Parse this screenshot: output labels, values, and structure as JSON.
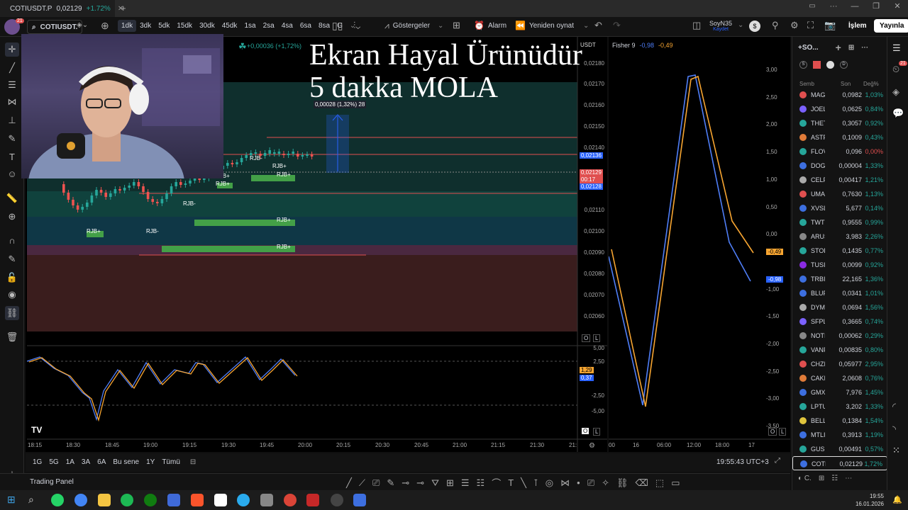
{
  "window": {
    "tab_title": "COTIUSDT.P",
    "tab_price": "0,02129",
    "tab_change": "+1.72%",
    "controls": [
      "—",
      "❐",
      "✕"
    ]
  },
  "toolbar": {
    "symbol": "COTIUSDT.",
    "intervals": [
      "1dk",
      "3dk",
      "5dk",
      "15dk",
      "30dk",
      "45dk",
      "1sa",
      "2sa",
      "4sa",
      "6sa",
      "8sa",
      "G"
    ],
    "active_interval": "1dk",
    "indicators": "Göstergeler",
    "alarm": "Alarm",
    "replay": "Yeniden oynat",
    "layout_name": "SoyN35",
    "layout_saved": "Kaydet",
    "trade": "İşlem",
    "publish": "Yayınla",
    "notif_count": "21"
  },
  "chart": {
    "change_label": "+0,00036 (+1,72%)",
    "currency": "USDT",
    "measure_label": "0,00028 (1,32%) 28",
    "price_axis": [
      "0,02180",
      "0,02170",
      "0,02160",
      "0,02150",
      "0,02140",
      "0,02110",
      "0,02100",
      "0,02090",
      "0,02080",
      "0,02070",
      "0,02060"
    ],
    "price_badges": {
      "upper": "0,02136",
      "current": "0,02129",
      "countdown": "00:17",
      "lower": "0,02128"
    },
    "zone_labels": [
      "RJB+",
      "RJB-",
      "RJB+",
      "RJB+",
      "RJB-",
      "RJB+",
      "RJB-",
      "RJB+",
      "RJB+",
      "RJB+"
    ],
    "osc_axis": [
      "5,00",
      "2,50",
      "-2,50",
      "-5,00"
    ],
    "osc_badges": [
      "1,29",
      "0,37"
    ],
    "time_axis": [
      "18:15",
      "18:30",
      "18:45",
      "19:00",
      "19:15",
      "19:30",
      "19:45",
      "20:00",
      "20:15",
      "20:30",
      "20:45",
      "21:00",
      "21:15",
      "21:30",
      "21:"
    ],
    "scale_buttons": [
      "O",
      "L"
    ]
  },
  "fisher": {
    "title": "Fisher 9",
    "v1": "-0,98",
    "v2": "-0,49",
    "axis": [
      "3,00",
      "2,50",
      "2,00",
      "1,50",
      "1,00",
      "0,50",
      "0,00",
      "-1,00",
      "-1,50",
      "-2,00",
      "-2,50",
      "-3,00",
      "-3,50"
    ],
    "time_axis": [
      "00",
      "16",
      "06:00",
      "12:00",
      "18:00",
      "17"
    ],
    "badge_orange": "-0,49",
    "badge_blue": "-0,98",
    "colors": {
      "fisher": "#4f7ef7",
      "trigger": "#f7a531"
    }
  },
  "overlay": {
    "line1": "Ekran Hayal Ürünüdür",
    "line2": "5 dakka MOLA"
  },
  "bottombar": {
    "ranges": [
      "1G",
      "5G",
      "1A",
      "3A",
      "6A",
      "Bu sene",
      "1Y",
      "Tümü"
    ],
    "clock": "19:55:43 UTC+3"
  },
  "trading_panel": "Trading Panel",
  "watchlist": {
    "title": "+SO...",
    "columns": [
      "Semb",
      "Son",
      "Değ%"
    ],
    "rows": [
      {
        "name": "MAG",
        "price": "0,0982",
        "change": "1,03%",
        "color": "#e04f4f"
      },
      {
        "name": "JOEL",
        "price": "0,0625",
        "change": "0,84%",
        "color": "#7b61ff"
      },
      {
        "name": "THET",
        "price": "0,3057",
        "change": "0,92%",
        "color": "#26a69a"
      },
      {
        "name": "ASTF",
        "price": "0,1009",
        "change": "0,43%",
        "color": "#e07b39"
      },
      {
        "name": "FLOV",
        "price": "0,096",
        "change": "0,00%",
        "color": "#26a69a"
      },
      {
        "name": "DOG",
        "price": "0,00004",
        "change": "1,33%",
        "color": "#3d6fe0"
      },
      {
        "name": "CELF",
        "price": "0,00417",
        "change": "1,21%",
        "color": "#aaaaaa"
      },
      {
        "name": "UMA",
        "price": "0,7630",
        "change": "1,13%",
        "color": "#e04f4f"
      },
      {
        "name": "XVSL",
        "price": "5,677",
        "change": "0,14%",
        "color": "#3d6fe0"
      },
      {
        "name": "TWT",
        "price": "0,9555",
        "change": "0,99%",
        "color": "#26a69a"
      },
      {
        "name": "ARUS",
        "price": "3,983",
        "change": "2,26%",
        "color": "#888888"
      },
      {
        "name": "STOF",
        "price": "0,1435",
        "change": "0,77%",
        "color": "#26a69a"
      },
      {
        "name": "TUSI",
        "price": "0,0099",
        "change": "0,92%",
        "color": "#8a2be2"
      },
      {
        "name": "TRBI",
        "price": "22,165",
        "change": "1,36%",
        "color": "#3d6fe0"
      },
      {
        "name": "BLUF",
        "price": "0,0341",
        "change": "1,01%",
        "color": "#3d6fe0"
      },
      {
        "name": "DYMI",
        "price": "0,0694",
        "change": "1,56%",
        "color": "#aaaaaa"
      },
      {
        "name": "SFPL",
        "price": "0,3665",
        "change": "0,74%",
        "color": "#7b61ff"
      },
      {
        "name": "NOTI",
        "price": "0,00062",
        "change": "0,29%",
        "color": "#888888"
      },
      {
        "name": "VANF",
        "price": "0,00835",
        "change": "0,80%",
        "color": "#26a69a"
      },
      {
        "name": "CHZI",
        "price": "0,05977",
        "change": "2,95%",
        "color": "#e04f4f"
      },
      {
        "name": "CAKI",
        "price": "2,0608",
        "change": "0,76%",
        "color": "#e07b39"
      },
      {
        "name": "GMX",
        "price": "7,976",
        "change": "1,45%",
        "color": "#3d6fe0"
      },
      {
        "name": "LPTU",
        "price": "3,202",
        "change": "1,33%",
        "color": "#26a69a"
      },
      {
        "name": "BELL",
        "price": "0,1384",
        "change": "1,54%",
        "color": "#e0c53d"
      },
      {
        "name": "MTLI",
        "price": "0,3913",
        "change": "1,19%",
        "color": "#3d6fe0"
      },
      {
        "name": "GUSI",
        "price": "0,00491",
        "change": "0,57%",
        "color": "#26a69a"
      },
      {
        "name": "COTI",
        "price": "0,02129",
        "change": "1,72%",
        "color": "#3d6fe0"
      }
    ]
  },
  "taskbar": {
    "time": "19:55",
    "date": "16.01.2026"
  }
}
